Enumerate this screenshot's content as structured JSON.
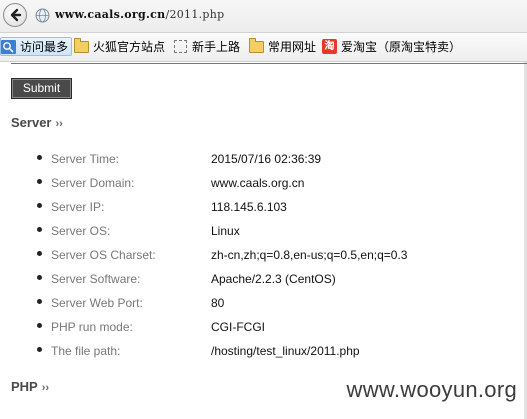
{
  "browser": {
    "address_url_domain": "www.caals.org.cn",
    "address_url_path": "/2011.php",
    "bookmarks": [
      {
        "label": "访问最多",
        "icon": "search-icon"
      },
      {
        "label": "火狐官方站点",
        "icon": "folder-icon"
      },
      {
        "label": "新手上路",
        "icon": "blank-page-icon"
      },
      {
        "label": "常用网址",
        "icon": "folder-icon"
      },
      {
        "label": "爱淘宝（原淘宝特卖）",
        "icon": "taobao-icon"
      }
    ],
    "taobao_icon_glyph": "淘"
  },
  "page": {
    "submit_label": "Submit",
    "server_heading": "Server",
    "php_heading": "PHP",
    "raquo": "››",
    "server_info": [
      {
        "label": "Server Time:",
        "value": "2015/07/16 02:36:39"
      },
      {
        "label": "Server Domain:",
        "value": "www.caals.org.cn"
      },
      {
        "label": "Server IP:",
        "value": "118.145.6.103"
      },
      {
        "label": "Server OS:",
        "value": "Linux"
      },
      {
        "label": "Server OS Charset:",
        "value": "zh-cn,zh;q=0.8,en-us;q=0.5,en;q=0.3"
      },
      {
        "label": "Server Software:",
        "value": "Apache/2.2.3 (CentOS)"
      },
      {
        "label": "Server Web Port:",
        "value": "80"
      },
      {
        "label": "PHP run mode:",
        "value": "CGI-FCGI"
      },
      {
        "label": "The file path:",
        "value": "/hosting/test_linux/2011.php"
      }
    ]
  },
  "watermark": "www.wooyun.org",
  "colors": {
    "heading": "#4a4a4a",
    "label": "#777777",
    "value": "#111111",
    "button_bg": "#4a4a4a",
    "taobao_red": "#e4392b",
    "folder_yellow": "#f2cf63"
  }
}
